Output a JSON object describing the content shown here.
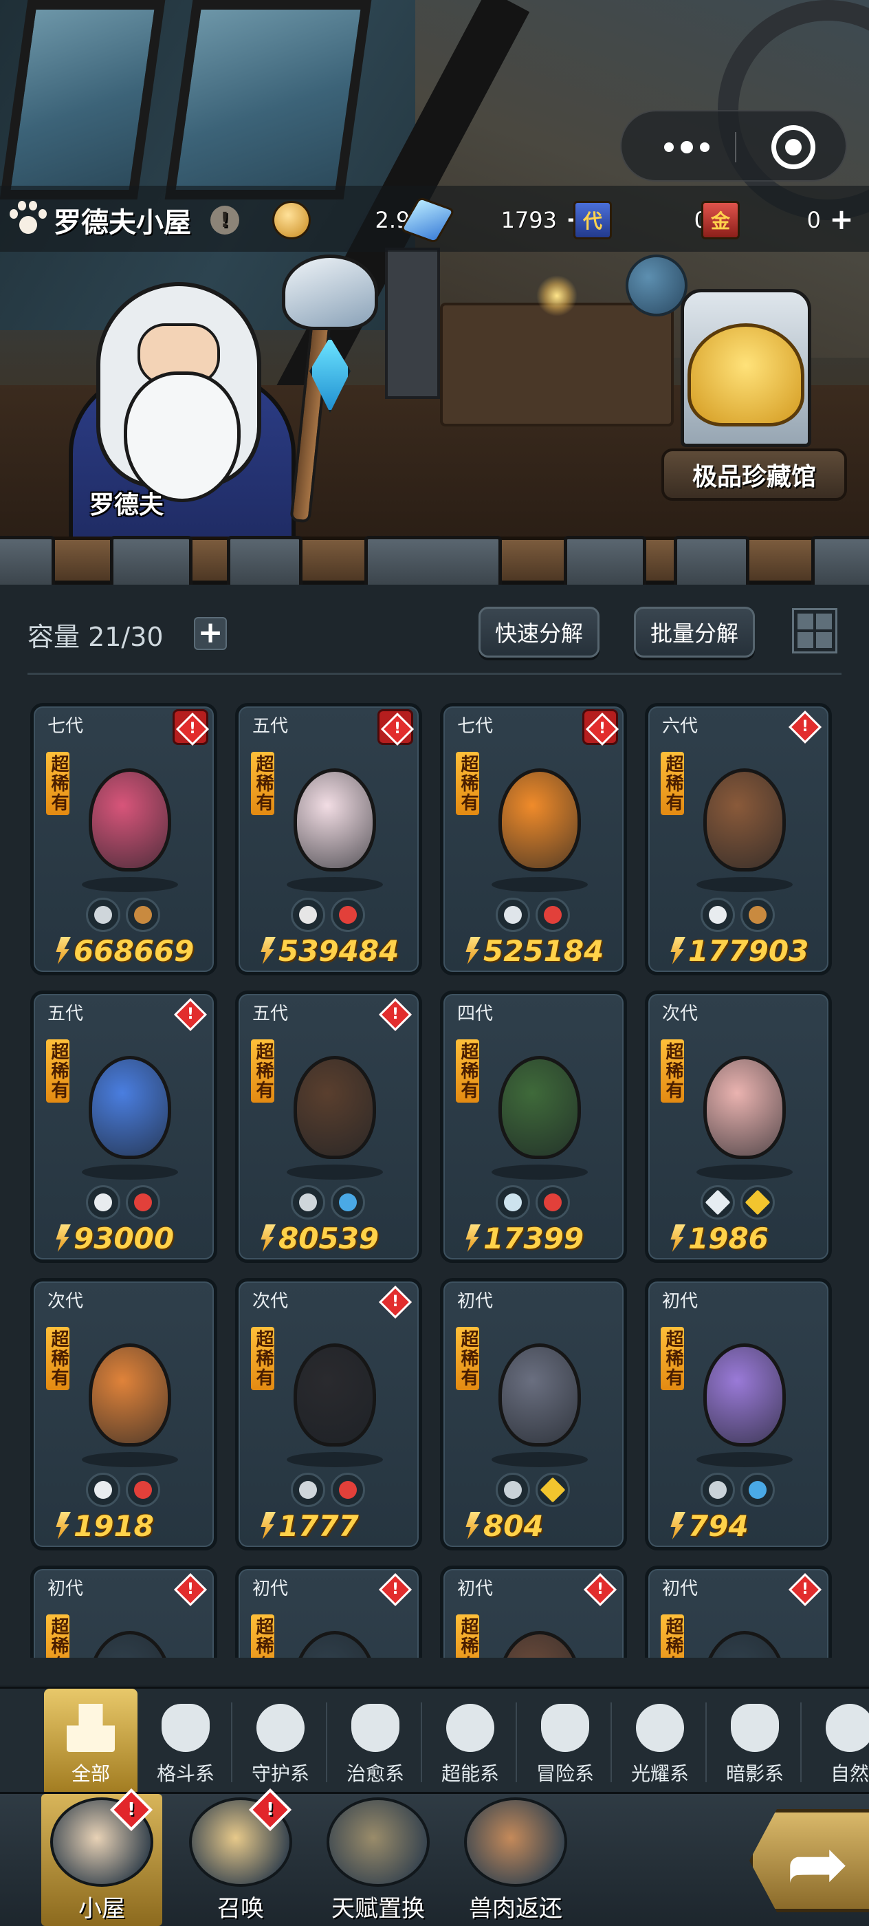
{
  "header": {
    "home_title": "罗德夫小屋",
    "info_label": "!",
    "resources": [
      {
        "icon": "gold-coin-icon",
        "value": "2.9M",
        "has_plus": false
      },
      {
        "icon": "diamond-icon",
        "value": "1793",
        "has_plus": true
      },
      {
        "icon": "blue-ticket-icon",
        "badge": "代",
        "value": "0",
        "has_plus": false
      },
      {
        "icon": "gold-ticket-icon",
        "badge": "金",
        "value": "0",
        "has_plus": true
      }
    ],
    "plus_glyph": "+"
  },
  "scene": {
    "npc_name": "罗德夫",
    "collection_button": "极品珍藏馆"
  },
  "inventory": {
    "capacity_label": "容量 21/30",
    "capacity_plus": "+",
    "quick_decompose": "快速分解",
    "batch_decompose": "批量分解",
    "cards": [
      {
        "generation": "七代",
        "rarity": "超稀有",
        "power": "668669",
        "alert": "box",
        "types": [
          "guard",
          "adventure"
        ],
        "color": "#d8557a"
      },
      {
        "generation": "五代",
        "rarity": "超稀有",
        "power": "539484",
        "alert": "box",
        "types": [
          "psychic",
          "fire"
        ],
        "color": "#f2dde4"
      },
      {
        "generation": "七代",
        "rarity": "超稀有",
        "power": "525184",
        "alert": "box",
        "types": [
          "heal",
          "fire"
        ],
        "color": "#f08b2a"
      },
      {
        "generation": "六代",
        "rarity": "超稀有",
        "power": "177903",
        "alert": "diamond",
        "types": [
          "fight",
          "adventure"
        ],
        "color": "#8a5a3a"
      },
      {
        "generation": "五代",
        "rarity": "超稀有",
        "power": "93000",
        "alert": "diamond",
        "types": [
          "fight",
          "fire"
        ],
        "color": "#4a7ee0"
      },
      {
        "generation": "五代",
        "rarity": "超稀有",
        "power": "80539",
        "alert": "diamond",
        "types": [
          "guard",
          "water"
        ],
        "color": "#5a3f2e"
      },
      {
        "generation": "四代",
        "rarity": "超稀有",
        "power": "17399",
        "alert": "none",
        "types": [
          "wind",
          "fire"
        ],
        "color": "#3f6a3a"
      },
      {
        "generation": "次代",
        "rarity": "超稀有",
        "power": "1986",
        "alert": "none",
        "types": [
          "light",
          "star"
        ],
        "color": "#eab3b0"
      },
      {
        "generation": "次代",
        "rarity": "超稀有",
        "power": "1918",
        "alert": "none",
        "types": [
          "fight",
          "fire"
        ],
        "color": "#e0833a"
      },
      {
        "generation": "次代",
        "rarity": "超稀有",
        "power": "1777",
        "alert": "diamond",
        "types": [
          "guard",
          "fire"
        ],
        "color": "#2a2a2e"
      },
      {
        "generation": "初代",
        "rarity": "超稀有",
        "power": "804",
        "alert": "none",
        "types": [
          "shadow",
          "star"
        ],
        "color": "#6a6f80"
      },
      {
        "generation": "初代",
        "rarity": "超稀有",
        "power": "794",
        "alert": "none",
        "types": [
          "shadow",
          "water"
        ],
        "color": "#9a7ad8"
      },
      {
        "generation": "初代",
        "rarity": "超稀有",
        "power": "",
        "alert": "diamond",
        "types": [],
        "color": "#30404c"
      },
      {
        "generation": "初代",
        "rarity": "超稀有",
        "power": "",
        "alert": "diamond",
        "types": [],
        "color": "#30404c"
      },
      {
        "generation": "初代",
        "rarity": "超稀有",
        "power": "",
        "alert": "diamond",
        "types": [],
        "color": "#6a4a3a"
      },
      {
        "generation": "初代",
        "rarity": "超稀有",
        "power": "",
        "alert": "diamond",
        "types": [],
        "color": "#30404c"
      }
    ]
  },
  "categories": [
    {
      "label": "全部",
      "icon": "all-icon",
      "active": true
    },
    {
      "label": "格斗系",
      "icon": "fist-icon",
      "active": false
    },
    {
      "label": "守护系",
      "icon": "shield-icon",
      "active": false
    },
    {
      "label": "治愈系",
      "icon": "sprout-icon",
      "active": false
    },
    {
      "label": "超能系",
      "icon": "alien-icon",
      "active": false
    },
    {
      "label": "冒险系",
      "icon": "lantern-icon",
      "active": false
    },
    {
      "label": "光耀系",
      "icon": "sparkle-icon",
      "active": false
    },
    {
      "label": "暗影系",
      "icon": "eye-icon",
      "active": false
    },
    {
      "label": "自然",
      "icon": "leaf-icon",
      "active": false
    }
  ],
  "nav": [
    {
      "label": "小屋",
      "icon": "house-icon",
      "active": true,
      "badge": true
    },
    {
      "label": "召唤",
      "icon": "egg-icon",
      "active": false,
      "badge": true
    },
    {
      "label": "天赋置换",
      "icon": "swap-icon",
      "active": false,
      "badge": false
    },
    {
      "label": "兽肉返还",
      "icon": "meat-icon",
      "active": false,
      "badge": false
    }
  ],
  "colors": {
    "panel_bg": "#1e262c",
    "card_bg": "#2f3f4b",
    "power_gold": "#ffd24a",
    "rarity_orange": "#ffbf3a",
    "alert_red": "#e22d2d",
    "active_gold": "#e8c86a"
  }
}
